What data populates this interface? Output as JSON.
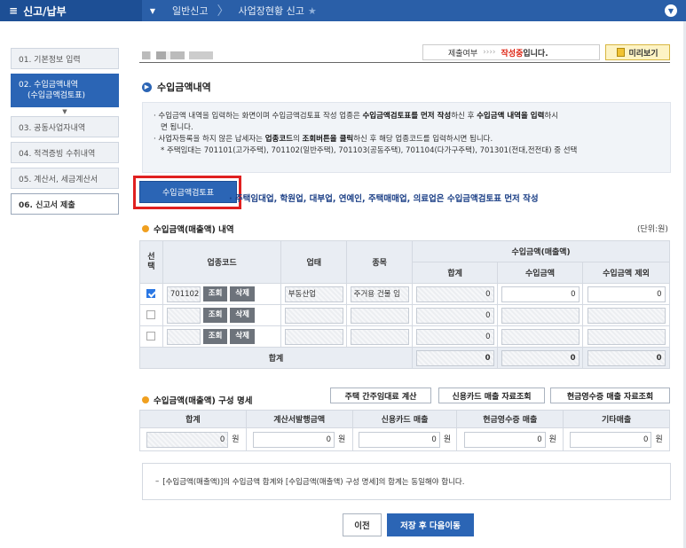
{
  "topbar": {
    "menu_label": "신고/납부",
    "crumbs": [
      "일반신고",
      "사업장현황 신고"
    ]
  },
  "sidebar": {
    "items": [
      {
        "label": "01. 기본정보 입력"
      },
      {
        "label1": "02. 수입금액내역",
        "label2": "(수입금액검토표)"
      },
      {
        "label": "03. 공동사업자내역"
      },
      {
        "label": "04. 적격증빙 수취내역"
      },
      {
        "label": "05. 계산서, 세금계산서"
      },
      {
        "label": "06. 신고서 제출"
      }
    ]
  },
  "header": {
    "status_label": "제출여부",
    "status_arrows": "››››",
    "status_value": "작성중",
    "status_suffix": "입니다.",
    "preview_label": "미리보기"
  },
  "section": {
    "title": "수입금액내역",
    "info_line1_a": "수입금액 내역을 입력하는 화면이며 수입금액검토표 작성 업종은 ",
    "info_line1_b": "수입금액검토표를 먼저 작성",
    "info_line1_c": "하신 후 ",
    "info_line1_d": "수입금액 내역을 입력",
    "info_line1_e": "하시",
    "info_line2": "면 됩니다.",
    "info_line3_a": "사업자등록을 하지 않은 납세자는 ",
    "info_line3_b": "업종코드",
    "info_line3_c": "의 ",
    "info_line3_d": "조회버튼을 클릭",
    "info_line3_e": "하신 후 해당 업종코드를 입력하시면 됩니다.",
    "info_line4": "* 주택임대는 701101(고가주택), 701102(일반주택), 701103(공동주택), 701104(다가구주택), 701301(전대,전전대) 중 선택",
    "review_button": "수입금액검토표",
    "review_note": "주택임대업, 학원업, 대부업, 연예인, 주택매매업, 의료업은 수입금액검토표 먼저 작성"
  },
  "revenue_table": {
    "title": "수입금액(매출액) 내역",
    "unit": "(단위:원)",
    "headers": {
      "select": "선택",
      "industry_code": "업종코드",
      "business_type": "업태",
      "item": "종목",
      "revenue_group": "수입금액(매출액)",
      "total": "합계",
      "revenue": "수입금액",
      "excluded": "수입금액 제외"
    },
    "lookup_label": "조회",
    "delete_label": "삭제",
    "rows": [
      {
        "code": "701102",
        "type": "부동산업",
        "item": "주거용 건물 임",
        "total": "0",
        "revenue": "0",
        "excluded": "0"
      },
      {
        "code": "",
        "type": "",
        "item": "",
        "total": "0",
        "revenue": "",
        "excluded": ""
      },
      {
        "code": "",
        "type": "",
        "item": "",
        "total": "0",
        "revenue": "",
        "excluded": ""
      }
    ],
    "sum_label": "합계",
    "sum_total": "0",
    "sum_revenue": "0",
    "sum_excluded": "0"
  },
  "composition": {
    "title": "수입금액(매출액) 구성 명세",
    "btn_housing": "주택 간주임대료 계산",
    "btn_card": "신용카드 매출 자료조회",
    "btn_cash": "현금영수증 매출 자료조회",
    "headers": [
      "합계",
      "계산서발행금액",
      "신용카드 매출",
      "현금영수증 매출",
      "기타매출"
    ],
    "values": [
      "0",
      "0",
      "0",
      "0",
      "0"
    ],
    "won": "원"
  },
  "note": "[수입금액(매출액)]의 수입금액 합계와 [수입금액(매출액) 구성 명세]의 합계는 동일해야 합니다.",
  "footer": {
    "prev": "이전",
    "next": "저장 후 다음이동"
  }
}
